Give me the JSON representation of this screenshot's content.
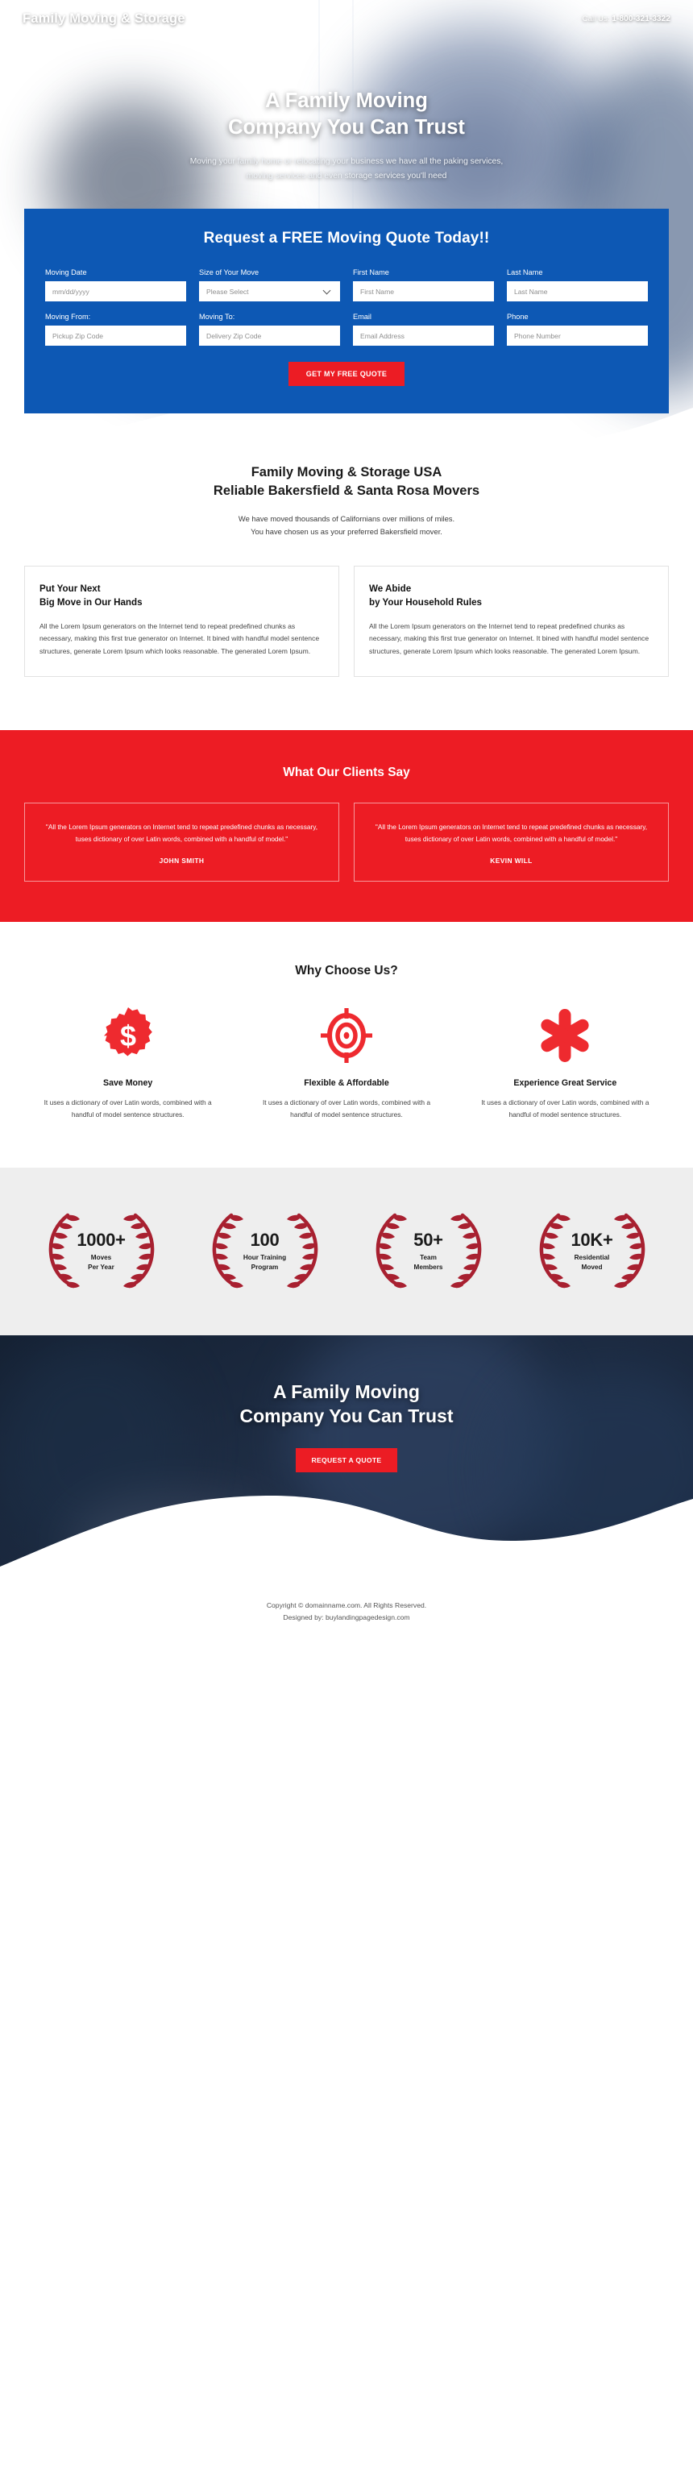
{
  "header": {
    "brand": "Family Moving & Storage",
    "call_prefix": "Call Us:",
    "phone": "1-800-321-3322"
  },
  "hero": {
    "title_line1": "A Family Moving",
    "title_line2": "Company You Can Trust",
    "sub_line1": "Moving your family home or relocating your business we have all the paking services,",
    "sub_line2": "moving services and even storage services you'll need"
  },
  "form": {
    "title": "Request a FREE Moving Quote Today!!",
    "fields": [
      {
        "label": "Moving Date",
        "placeholder": "mm/dd/yyyy",
        "type": "input"
      },
      {
        "label": "Size of Your Move",
        "placeholder": "Please Select",
        "type": "select"
      },
      {
        "label": "First Name",
        "placeholder": "First Name",
        "type": "input"
      },
      {
        "label": "Last Name",
        "placeholder": "Last Name",
        "type": "input"
      },
      {
        "label": "Moving From:",
        "placeholder": "Pickup Zip Code",
        "type": "input"
      },
      {
        "label": "Moving To:",
        "placeholder": "Delivery Zip Code",
        "type": "input"
      },
      {
        "label": "Email",
        "placeholder": "Email Address",
        "type": "input"
      },
      {
        "label": "Phone",
        "placeholder": "Phone Number",
        "type": "input"
      }
    ],
    "submit_label": "GET MY FREE QUOTE"
  },
  "intro": {
    "title_line1": "Family Moving & Storage USA",
    "title_line2": "Reliable Bakersfield & Santa Rosa Movers",
    "sub_line1": "We have moved thousands of Californians over millions of miles.",
    "sub_line2": "You have chosen us as your preferred Bakersfield mover.",
    "cards": [
      {
        "title_line1": "Put Your Next",
        "title_line2": "Big Move in Our Hands",
        "body": "All the Lorem Ipsum generators on the Internet tend to repeat predefined chunks as necessary, making this first true generator on Internet. It bined with handful model sentence structures, generate Lorem Ipsum which looks reasonable. The generated Lorem Ipsum."
      },
      {
        "title_line1": "We Abide",
        "title_line2": "by Your Household Rules",
        "body": "All the Lorem Ipsum generators on the Internet tend to repeat predefined chunks as necessary, making this first true generator on Internet. It bined with handful model sentence structures, generate Lorem Ipsum which looks reasonable. The generated Lorem Ipsum."
      }
    ]
  },
  "testimonials": {
    "title": "What Our Clients Say",
    "items": [
      {
        "quote": "\"All the Lorem Ipsum generators on Internet tend to repeat predefined chunks as necessary, tuses dictionary of over Latin words, combined with a handful of model.\"",
        "author": "JOHN SMITH"
      },
      {
        "quote": "\"All the Lorem Ipsum generators on Internet tend to repeat predefined chunks as necessary, tuses dictionary of over Latin words, combined with a handful of model.\"",
        "author": "KEVIN WILL"
      }
    ]
  },
  "why": {
    "title": "Why Choose Us?",
    "items": [
      {
        "icon": "dollar-badge-icon",
        "title": "Save Money",
        "body": "It uses a dictionary of over Latin words, combined with a handful of model sentence structures."
      },
      {
        "icon": "target-icon",
        "title": "Flexible & Affordable",
        "body": "It uses a dictionary of over Latin words, combined with a handful of model sentence structures."
      },
      {
        "icon": "asterisk-icon",
        "title": "Experience Great Service",
        "body": "It uses a dictionary of over Latin words, combined with a handful of model sentence structures."
      }
    ]
  },
  "stats": [
    {
      "number": "1000+",
      "label_line1": "Moves",
      "label_line2": "Per Year"
    },
    {
      "number": "100",
      "label_line1": "Hour Training",
      "label_line2": "Program"
    },
    {
      "number": "50+",
      "label_line1": "Team",
      "label_line2": "Members"
    },
    {
      "number": "10K+",
      "label_line1": "Residential",
      "label_line2": "Moved"
    }
  ],
  "cta": {
    "title_line1": "A Family Moving",
    "title_line2": "Company You Can Trust",
    "button_label": "REQUEST A QUOTE"
  },
  "footer": {
    "copyright": "Copyright © domainname.com. All Rights Reserved.",
    "designed": "Designed by: buylandingpagedesign.com"
  },
  "colors": {
    "brand_blue": "#0d58b4",
    "accent_red": "#ed1c24",
    "laurel_red": "#a82030",
    "dark_navy": "#1d2b44"
  }
}
